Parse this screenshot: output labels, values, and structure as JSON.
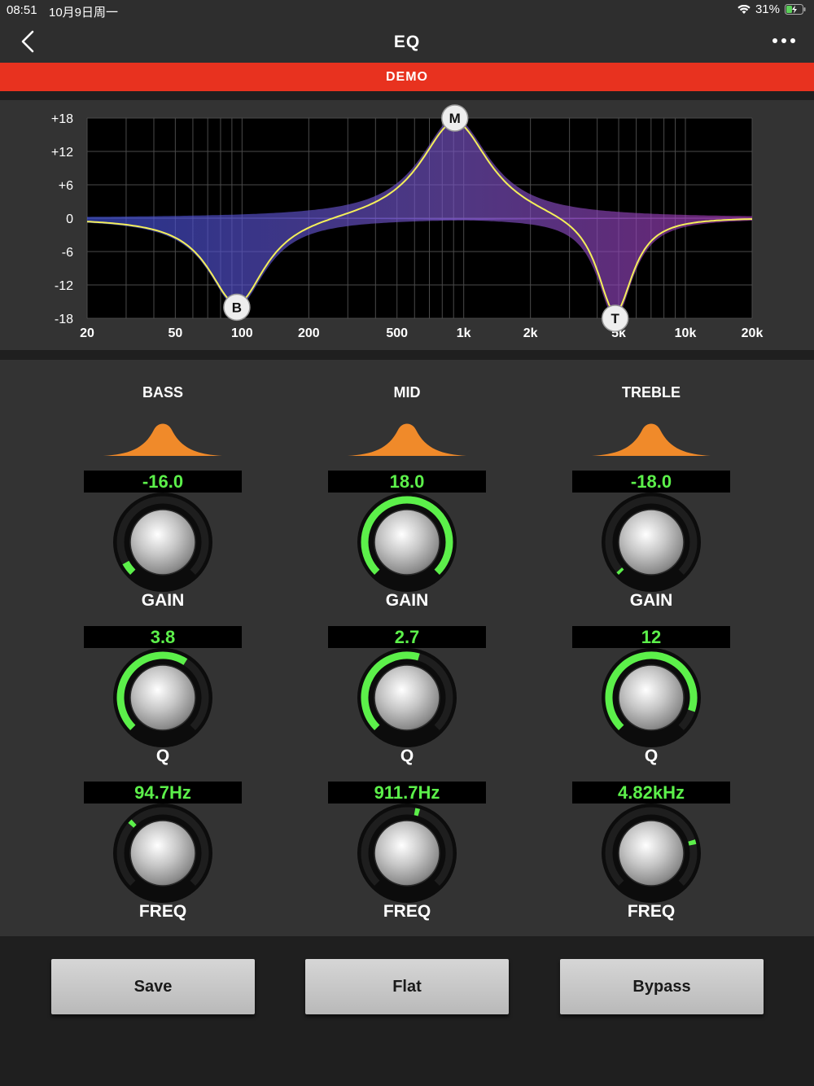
{
  "status": {
    "time": "08:51",
    "date": "10月9日周一",
    "battery": "31%"
  },
  "nav": {
    "title": "EQ",
    "back_icon": "chevron-left-icon",
    "more_icon": "ellipsis-icon"
  },
  "banner": {
    "text": "DEMO",
    "color": "#e8321f"
  },
  "graph": {
    "y_ticks": [
      "+18",
      "+12",
      "+6",
      "0",
      "-6",
      "-12",
      "-18"
    ],
    "x_ticks": [
      "20",
      "50",
      "100",
      "200",
      "500",
      "1k",
      "2k",
      "5k",
      "10k",
      "20k"
    ],
    "handles": [
      {
        "label": "B",
        "freq": 94.7,
        "gain": -16.0
      },
      {
        "label": "M",
        "freq": 911.7,
        "gain": 18.0
      },
      {
        "label": "T",
        "freq": 4820,
        "gain": -18.0
      }
    ],
    "curve_color": "#f4ef5a"
  },
  "bands": [
    {
      "name": "BASS",
      "gain": {
        "value": "-16.0",
        "label": "GAIN",
        "fraction": 0.06
      },
      "q": {
        "value": "3.8",
        "label": "Q",
        "fraction": 0.62
      },
      "freq": {
        "value": "94.7Hz",
        "label": "FREQ",
        "fraction": 0.33
      }
    },
    {
      "name": "MID",
      "gain": {
        "value": "18.0",
        "label": "GAIN",
        "fraction": 1.0
      },
      "q": {
        "value": "2.7",
        "label": "Q",
        "fraction": 0.56
      },
      "freq": {
        "value": "911.7Hz",
        "label": "FREQ",
        "fraction": 0.55
      }
    },
    {
      "name": "TREBLE",
      "gain": {
        "value": "-18.0",
        "label": "GAIN",
        "fraction": 0.0
      },
      "q": {
        "value": "12",
        "label": "Q",
        "fraction": 0.9
      },
      "freq": {
        "value": "4.82kHz",
        "label": "FREQ",
        "fraction": 0.78
      }
    }
  ],
  "buttons": {
    "save": "Save",
    "flat": "Flat",
    "bypass": "Bypass"
  },
  "colors": {
    "accent_green": "#5cf04a",
    "shape_orange": "#f08a2a",
    "panel": "#333333"
  }
}
